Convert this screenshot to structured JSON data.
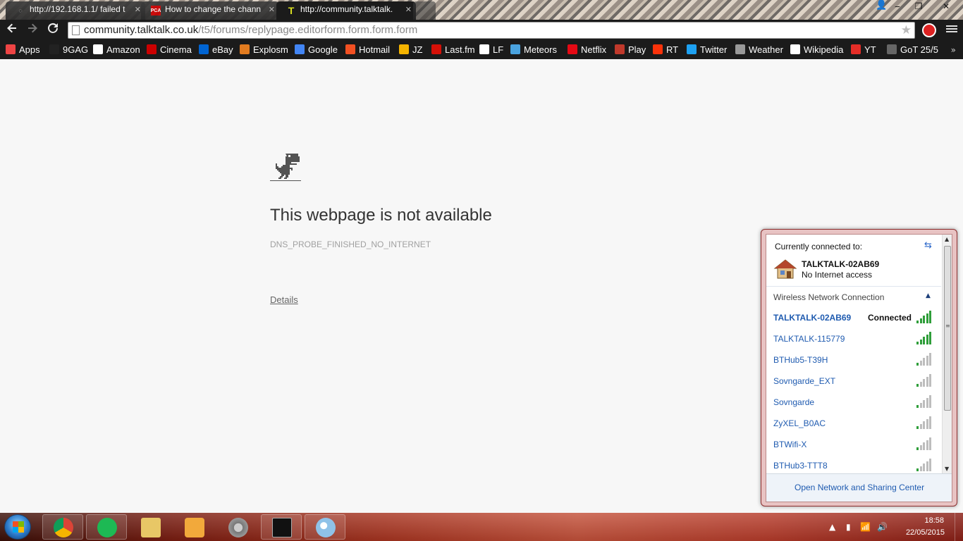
{
  "browser": {
    "tabs": [
      {
        "title": "http://192.168.1.1/ failed t",
        "favicon": "globe-icon"
      },
      {
        "title": "How to change the chann",
        "favicon": "pca-icon"
      },
      {
        "title": "http://community.talktalk.",
        "favicon": "talktalk-icon"
      }
    ],
    "window_controls": {
      "minimize": "‒",
      "restore": "❐",
      "close": "✕"
    },
    "address": {
      "host": "community.talktalk.co.uk",
      "path": "/t5/forums/replypage.editorform.form.form.form"
    },
    "bookmarks": [
      {
        "label": "Apps",
        "icon": "apps-icon",
        "color": "#e44"
      },
      {
        "label": "9GAG",
        "icon": "9gag-icon",
        "color": "#222"
      },
      {
        "label": "Amazon",
        "icon": "amazon-icon",
        "color": "#fff"
      },
      {
        "label": "Cinema",
        "icon": "cinema-icon",
        "color": "#c00"
      },
      {
        "label": "eBay",
        "icon": "ebay-icon",
        "color": "#0064d2"
      },
      {
        "label": "Explosm",
        "icon": "explosm-icon",
        "color": "#e27b1f"
      },
      {
        "label": "Google",
        "icon": "google-icon",
        "color": "#4285f4"
      },
      {
        "label": "Hotmail",
        "icon": "hotmail-icon",
        "color": "#f25022"
      },
      {
        "label": "JZ",
        "icon": "jz-icon",
        "color": "#f5b400"
      },
      {
        "label": "Last.fm",
        "icon": "lastfm-icon",
        "color": "#d51007"
      },
      {
        "label": "LF",
        "icon": "lf-icon",
        "color": "#fff"
      },
      {
        "label": "Meteors",
        "icon": "meteors-icon",
        "color": "#4aa3df"
      },
      {
        "label": "Netflix",
        "icon": "netflix-icon",
        "color": "#e50914"
      },
      {
        "label": "Play",
        "icon": "play-icon",
        "color": "#c0392b"
      },
      {
        "label": "RT",
        "icon": "rt-icon",
        "color": "#fa320a"
      },
      {
        "label": "Twitter",
        "icon": "twitter-icon",
        "color": "#1da1f2"
      },
      {
        "label": "Weather",
        "icon": "weather-icon",
        "color": "#999"
      },
      {
        "label": "Wikipedia",
        "icon": "wikipedia-icon",
        "color": "#fff"
      },
      {
        "label": "YT",
        "icon": "youtube-icon",
        "color": "#e52d27"
      },
      {
        "label": "GoT 25/5",
        "icon": "got-icon",
        "color": "#666"
      }
    ],
    "bookmarks_overflow": "»"
  },
  "error_page": {
    "title": "This webpage is not available",
    "code": "DNS_PROBE_FINISHED_NO_INTERNET",
    "details_link": "Details"
  },
  "network_flyout": {
    "header": "Currently connected to:",
    "current": {
      "name": "TALKTALK-02AB69",
      "status": "No Internet access"
    },
    "section_label": "Wireless Network Connection",
    "networks": [
      {
        "name": "TALKTALK-02AB69",
        "status": "Connected",
        "bars": 5
      },
      {
        "name": "TALKTALK-115779",
        "status": "",
        "bars": 5
      },
      {
        "name": "BTHub5-T39H",
        "status": "",
        "bars": 1
      },
      {
        "name": "Sovngarde_EXT",
        "status": "",
        "bars": 1
      },
      {
        "name": "Sovngarde",
        "status": "",
        "bars": 1
      },
      {
        "name": "ZyXEL_B0AC",
        "status": "",
        "bars": 1
      },
      {
        "name": "BTWifi-X",
        "status": "",
        "bars": 1
      },
      {
        "name": "BTHub3-TTT8",
        "status": "",
        "bars": 1
      }
    ],
    "footer_link": "Open Network and Sharing Center"
  },
  "taskbar": {
    "pinned": [
      {
        "name": "chrome"
      },
      {
        "name": "spotify"
      },
      {
        "name": "explorer"
      },
      {
        "name": "media-player"
      },
      {
        "name": "settings"
      },
      {
        "name": "cmd"
      },
      {
        "name": "paint"
      }
    ],
    "clock": {
      "time": "18:58",
      "date": "22/05/2015"
    }
  }
}
